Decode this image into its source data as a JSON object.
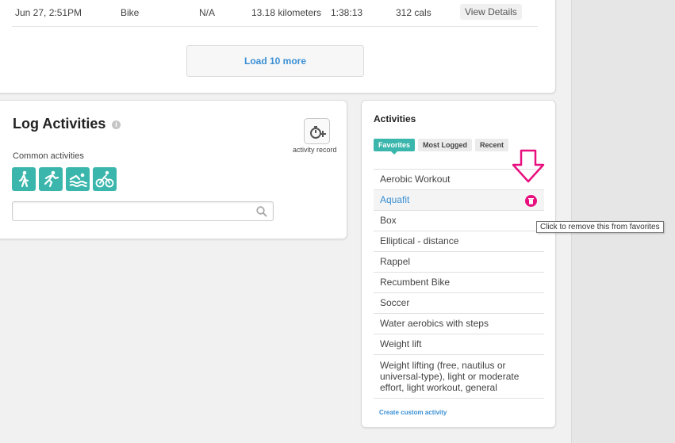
{
  "recent": {
    "row": {
      "date": "Jun 27, 2:51PM",
      "type": "Bike",
      "steps": "N/A",
      "distance": "13.18 kilometers",
      "duration": "1:38:13",
      "calories": "312 cals",
      "view_label": "View Details"
    },
    "load_more_label": "Load 10 more"
  },
  "log": {
    "title": "Log Activities",
    "info_icon": "i",
    "record_label": "activity record",
    "common_label": "Common activities",
    "common_icons": [
      "walking-icon",
      "running-icon",
      "swimming-icon",
      "cycling-icon"
    ],
    "search_placeholder": ""
  },
  "activities": {
    "title": "Activities",
    "tabs": [
      "Favorites",
      "Most Logged",
      "Recent"
    ],
    "active_tab": "Favorites",
    "favorites": [
      "Aerobic Workout",
      "Aquafit",
      "Box",
      "Elliptical - distance",
      "Rappel",
      "Recumbent Bike",
      "Soccer",
      "Water aerobics with steps",
      "Weight lift",
      "Weight lifting (free, nautilus or universal-type), light or moderate effort, light workout, general"
    ],
    "hovered_item": "Aquafit",
    "create_label": "Create custom activity",
    "tooltip": "Click to remove this from favorites"
  },
  "colors": {
    "accent_teal": "#3ab6ac",
    "link_blue": "#3a8fd4",
    "annotation_pink": "#e8107f"
  }
}
